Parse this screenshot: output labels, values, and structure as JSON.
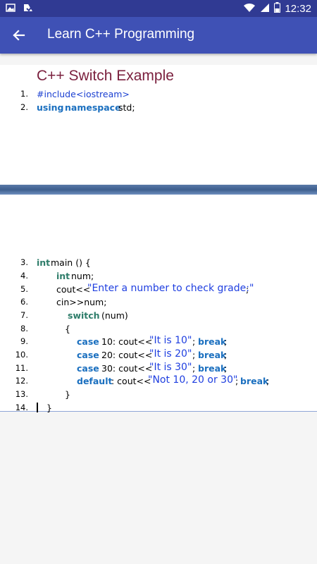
{
  "status": {
    "time": "12:32",
    "icons": [
      "image-icon",
      "notification-icon",
      "wifi-icon",
      "signal-icon",
      "battery-icon"
    ]
  },
  "app_bar": {
    "title": "Learn C++ Programming",
    "back_icon": "arrow-left-icon"
  },
  "example": {
    "title": "C++ Switch Example"
  },
  "code": {
    "l1": {
      "n": "1.",
      "include": "#include",
      "header": "<iostream>"
    },
    "l2": {
      "n": "2.",
      "kw1": "using",
      "kw2": "namespace",
      "rest": "std;"
    },
    "l3": {
      "n": "3.",
      "kw": "int",
      "rest": "main () {"
    },
    "l4": {
      "n": "4.",
      "kw": "int",
      "rest": "num;"
    },
    "l5": {
      "n": "5.",
      "pre": "cout<<",
      "str": "\"Enter a number to check grade:\"",
      "post": ";"
    },
    "l6": {
      "n": "6.",
      "text": "cin>>num;"
    },
    "l7": {
      "n": "7.",
      "kw": "switch",
      "rest": "(num)"
    },
    "l8": {
      "n": "8.",
      "text": "{"
    },
    "l9": {
      "n": "9.",
      "kw": "case",
      "mid": "10: cout<<",
      "str": "\"It is 10\"",
      "semi": ";",
      "brk": "break",
      "end": ";"
    },
    "l10": {
      "n": "10.",
      "kw": "case",
      "mid": "20: cout<<",
      "str": "\"It is 20\"",
      "semi": ";",
      "brk": "break",
      "end": ";"
    },
    "l11": {
      "n": "11.",
      "kw": "case",
      "mid": "30: cout<<",
      "str": "\"It is 30\"",
      "semi": ";",
      "brk": "break",
      "end": ";"
    },
    "l12": {
      "n": "12.",
      "kw": "default",
      "mid": ": cout<<",
      "str": "\"Not 10, 20 or 30\"",
      "semi": ";",
      "brk": "break",
      "end": ";"
    },
    "l13": {
      "n": "13.",
      "text": "}"
    },
    "l14": {
      "n": "14.",
      "text": "}"
    }
  },
  "colors": {
    "app_bar": "#3f51b5",
    "status_bar": "#303a93",
    "title": "#7a1f3d",
    "keyword": "#1a6fbf",
    "type_keyword": "#2e7d6a",
    "string": "#1f3fe0"
  }
}
